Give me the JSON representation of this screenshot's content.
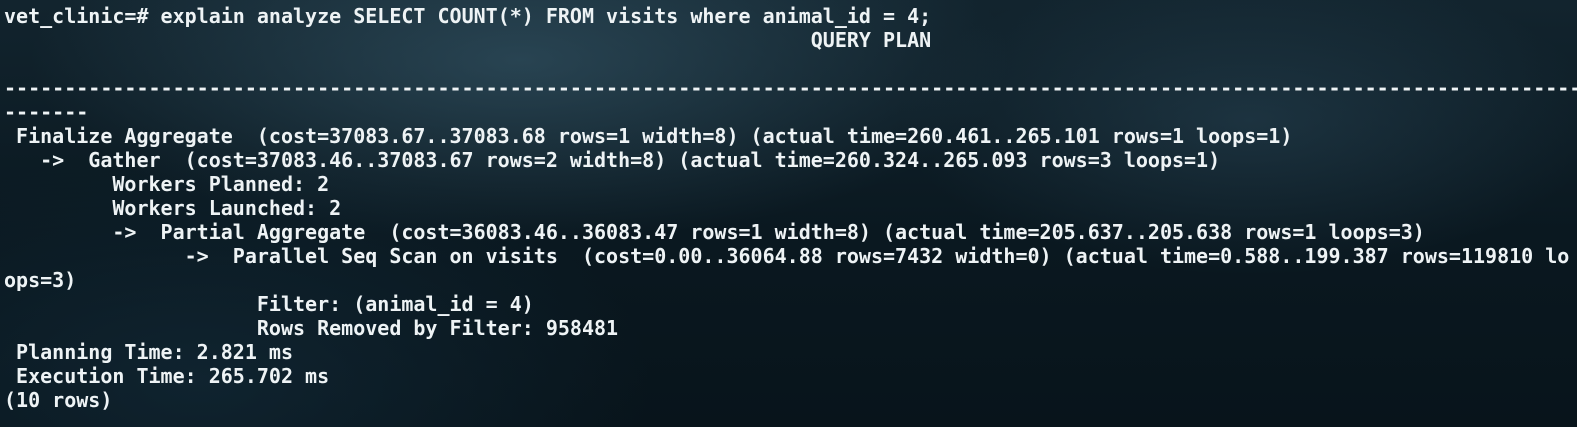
{
  "terminal": {
    "prompt": "vet_clinic=#",
    "command": " explain analyze SELECT COUNT(*) FROM visits where animal_id = 4;",
    "header": "                                                                   QUERY PLAN",
    "blank": "",
    "separator_1": "-------------------------------------------------------------------------------------------------------------------------------------------------",
    "separator_2": "-------",
    "plan": [
      " Finalize Aggregate  (cost=37083.67..37083.68 rows=1 width=8) (actual time=260.461..265.101 rows=1 loops=1)",
      "   ->  Gather  (cost=37083.46..37083.67 rows=2 width=8) (actual time=260.324..265.093 rows=3 loops=1)",
      "         Workers Planned: 2",
      "         Workers Launched: 2",
      "         ->  Partial Aggregate  (cost=36083.46..36083.47 rows=1 width=8) (actual time=205.637..205.638 rows=1 loops=3)",
      "               ->  Parallel Seq Scan on visits  (cost=0.00..36064.88 rows=7432 width=0) (actual time=0.588..199.387 rows=119810 lo",
      "ops=3)",
      "                     Filter: (animal_id = 4)",
      "                     Rows Removed by Filter: 958481",
      " Planning Time: 2.821 ms",
      " Execution Time: 265.702 ms",
      "(10 rows)"
    ]
  }
}
